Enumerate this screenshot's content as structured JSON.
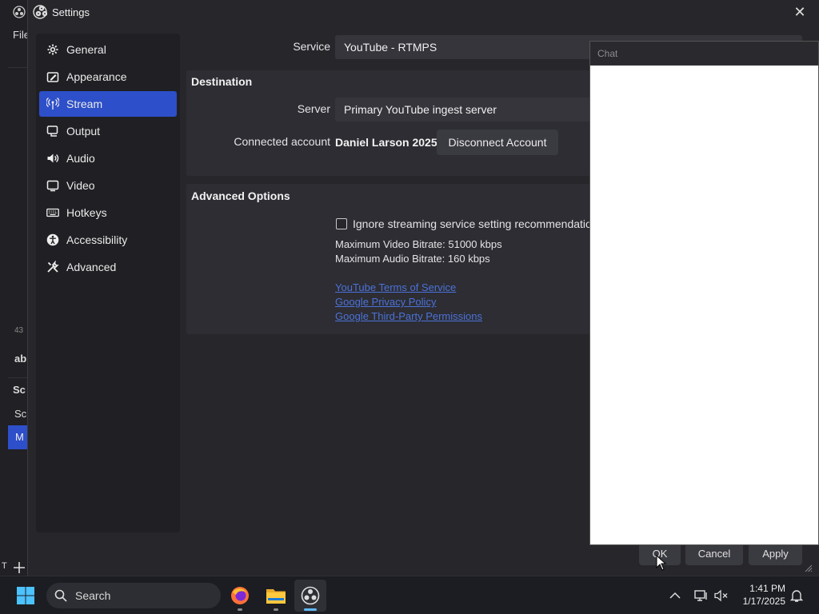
{
  "background": {
    "menu_file": "File",
    "item_43": "43",
    "item_ab": "ab",
    "item_sc_header": "Sc",
    "item_sc": "Sc",
    "item_m": "M",
    "item_t": "T"
  },
  "dialog": {
    "title": "Settings",
    "sidebar": [
      {
        "label": "General",
        "icon": "gear-icon"
      },
      {
        "label": "Appearance",
        "icon": "appearance-icon"
      },
      {
        "label": "Stream",
        "icon": "stream-icon",
        "active": true
      },
      {
        "label": "Output",
        "icon": "output-icon"
      },
      {
        "label": "Audio",
        "icon": "speaker-icon"
      },
      {
        "label": "Video",
        "icon": "monitor-icon"
      },
      {
        "label": "Hotkeys",
        "icon": "keyboard-icon"
      },
      {
        "label": "Accessibility",
        "icon": "accessibility-icon"
      },
      {
        "label": "Advanced",
        "icon": "tools-icon"
      }
    ],
    "service_label": "Service",
    "service_value": "YouTube - RTMPS",
    "destination": {
      "title": "Destination",
      "server_label": "Server",
      "server_value": "Primary YouTube ingest server",
      "account_label": "Connected account",
      "account_value": "Daniel Larson 2025",
      "disconnect_label": "Disconnect Account"
    },
    "advanced": {
      "title": "Advanced Options",
      "ignore_label": "Ignore streaming service setting recommendation",
      "ignore_checked": false,
      "max_video": "Maximum Video Bitrate: 51000 kbps",
      "max_audio": "Maximum Audio Bitrate: 160 kbps",
      "links": [
        "YouTube Terms of Service",
        "Google Privacy Policy",
        "Google Third-Party Permissions"
      ]
    },
    "buttons": {
      "ok": "OK",
      "cancel": "Cancel",
      "apply": "Apply"
    }
  },
  "chat": {
    "title": "Chat"
  },
  "taskbar": {
    "search_placeholder": "Search",
    "time": "1:41 PM",
    "date": "1/17/2025"
  },
  "colors": {
    "accent": "#2d4fc9",
    "link": "#4c72d8"
  }
}
